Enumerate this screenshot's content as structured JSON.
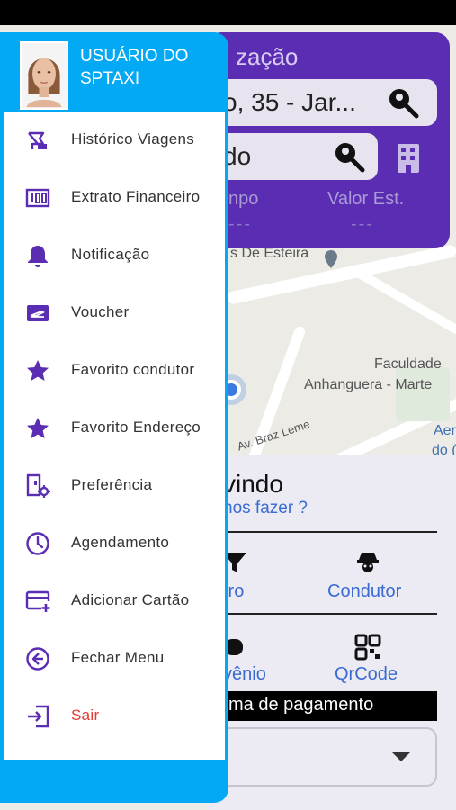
{
  "background_app": {
    "top_card": {
      "title_partial": "zação",
      "origin_partial": "o, 35 - Jar...",
      "destination_partial": "do",
      "time_label_partial": "npo",
      "value_label": "Valor Est.",
      "time_value": "---",
      "value_value": "---"
    },
    "map": {
      "street_1": "s De Esteira",
      "street_2": "Av. Braz Leme",
      "place_1": "Faculdade",
      "place_2": "Anhanguera - Marte",
      "place_3a": "Aer",
      "place_3b": "do (",
      "place_3c": "e"
    },
    "bottom_card": {
      "welcome_partial": "vindo",
      "question_partial": "nos fazer ?",
      "option_1_partial": "tro",
      "option_2": "Condutor",
      "option_3_partial": "vênio",
      "option_4": "QrCode",
      "payment_bar_partial": "ma de pagamento"
    }
  },
  "drawer": {
    "user_name": "USUÁRIO DO SPTAXI",
    "items": [
      {
        "label": "Histórico Viagens",
        "icon": "trip-history-icon"
      },
      {
        "label": "Extrato Financeiro",
        "icon": "statement-icon"
      },
      {
        "label": "Notificação",
        "icon": "bell-icon"
      },
      {
        "label": "Voucher",
        "icon": "voucher-icon"
      },
      {
        "label": "Favorito condutor",
        "icon": "star-icon"
      },
      {
        "label": "Favorito Endereço",
        "icon": "star-icon"
      },
      {
        "label": "Preferência",
        "icon": "preference-icon"
      },
      {
        "label": "Agendamento",
        "icon": "clock-icon"
      },
      {
        "label": "Adicionar Cartão",
        "icon": "add-card-icon"
      },
      {
        "label": "Fechar Menu",
        "icon": "back-circle-icon"
      },
      {
        "label": "Sair",
        "icon": "logout-icon"
      }
    ]
  },
  "colors": {
    "drawer_header": "#03a9f4",
    "icon_purple": "#5b2db3",
    "logout_red": "#e53935",
    "card_purple": "#5b2db3",
    "link_blue": "#3a6bd3"
  }
}
